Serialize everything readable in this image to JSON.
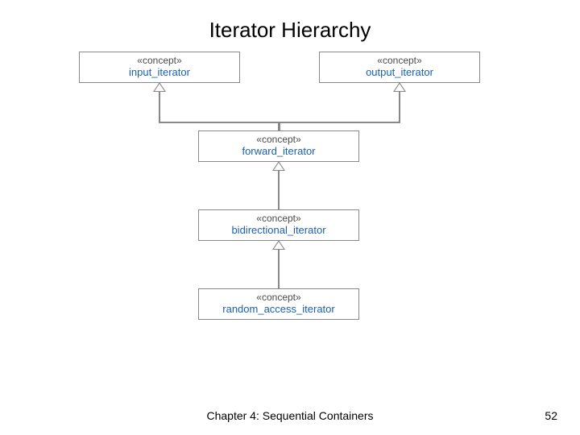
{
  "title": "Iterator Hierarchy",
  "stereotype": "«concept»",
  "nodes": {
    "input": {
      "name": "input_iterator"
    },
    "output": {
      "name": "output_iterator"
    },
    "forward": {
      "name": "forward_iterator"
    },
    "bidir": {
      "name": "bidirectional_iterator"
    },
    "random": {
      "name": "random_access_iterator"
    }
  },
  "edges": [
    {
      "from": "forward",
      "to": "input",
      "type": "generalization"
    },
    {
      "from": "forward",
      "to": "output",
      "type": "generalization"
    },
    {
      "from": "bidir",
      "to": "forward",
      "type": "generalization"
    },
    {
      "from": "random",
      "to": "bidir",
      "type": "generalization"
    }
  ],
  "footer": {
    "chapter": "Chapter 4: Sequential Containers",
    "page": "52"
  }
}
